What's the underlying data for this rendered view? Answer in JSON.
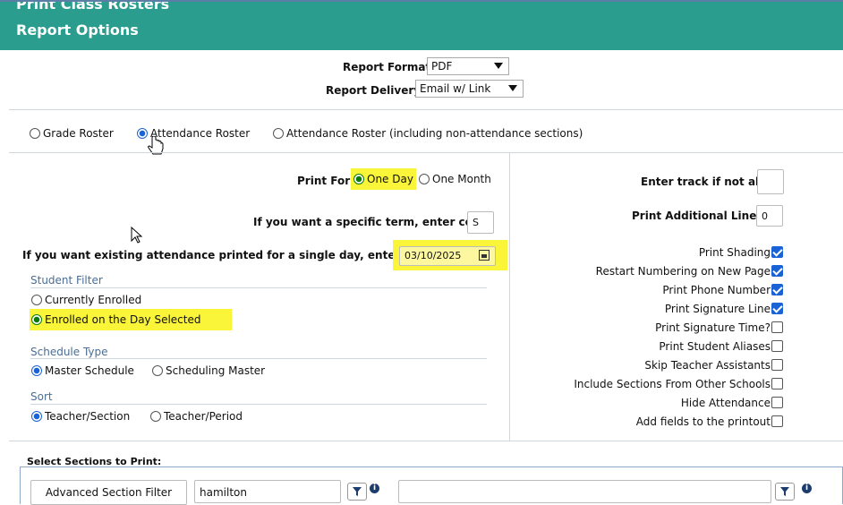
{
  "header": {
    "title": "Print Class Rosters",
    "subtitle": "Report Options"
  },
  "report": {
    "format_label": "Report Format:",
    "format_value": "PDF",
    "delivery_label": "Report Delivery:",
    "delivery_value": "Email w/ Link"
  },
  "roster_types": [
    {
      "label": "Grade Roster",
      "selected": false
    },
    {
      "label": "Attendance Roster",
      "selected": true
    },
    {
      "label": "Attendance Roster (including non-attendance sections)",
      "selected": false
    }
  ],
  "print_for": {
    "label": "Print For:",
    "opt1": "One Day",
    "opt2": "One Month"
  },
  "term": {
    "label": "If you want a specific term, enter code",
    "value": "S"
  },
  "date": {
    "label": "If you want existing attendance printed for a single day, enter a date",
    "value": "03/10/2025"
  },
  "student_filter": {
    "title": "Student Filter",
    "opt1": "Currently Enrolled",
    "opt2": "Enrolled on the Day Selected"
  },
  "schedule_type": {
    "title": "Schedule Type",
    "opt1": "Master Schedule",
    "opt2": "Scheduling Master"
  },
  "sort": {
    "title": "Sort",
    "opt1": "Teacher/Section",
    "opt2": "Teacher/Period"
  },
  "right": {
    "track_label": "Enter track if not all",
    "track_value": "",
    "lines_label": "Print Additional Lines",
    "lines_value": "0",
    "checks": [
      {
        "label": "Print Shading",
        "checked": true
      },
      {
        "label": "Restart Numbering on New Page",
        "checked": true
      },
      {
        "label": "Print Phone Number",
        "checked": true
      },
      {
        "label": "Print Signature Line",
        "checked": true
      },
      {
        "label": "Print Signature Time?",
        "checked": false
      },
      {
        "label": "Print Student Aliases",
        "checked": false
      },
      {
        "label": "Skip Teacher Assistants",
        "checked": false
      },
      {
        "label": "Include Sections From Other Schools",
        "checked": false
      },
      {
        "label": "Hide Attendance",
        "checked": false
      },
      {
        "label": "Add fields to the printout",
        "checked": false
      }
    ]
  },
  "sections": {
    "title": "Select Sections to Print:",
    "adv_button": "Advanced Section Filter",
    "filter1_value": "hamilton",
    "filter2_value": ""
  },
  "colors": {
    "header": "#2a9d8f",
    "highlight": "#fbf53a",
    "accent": "#1a63d6"
  }
}
